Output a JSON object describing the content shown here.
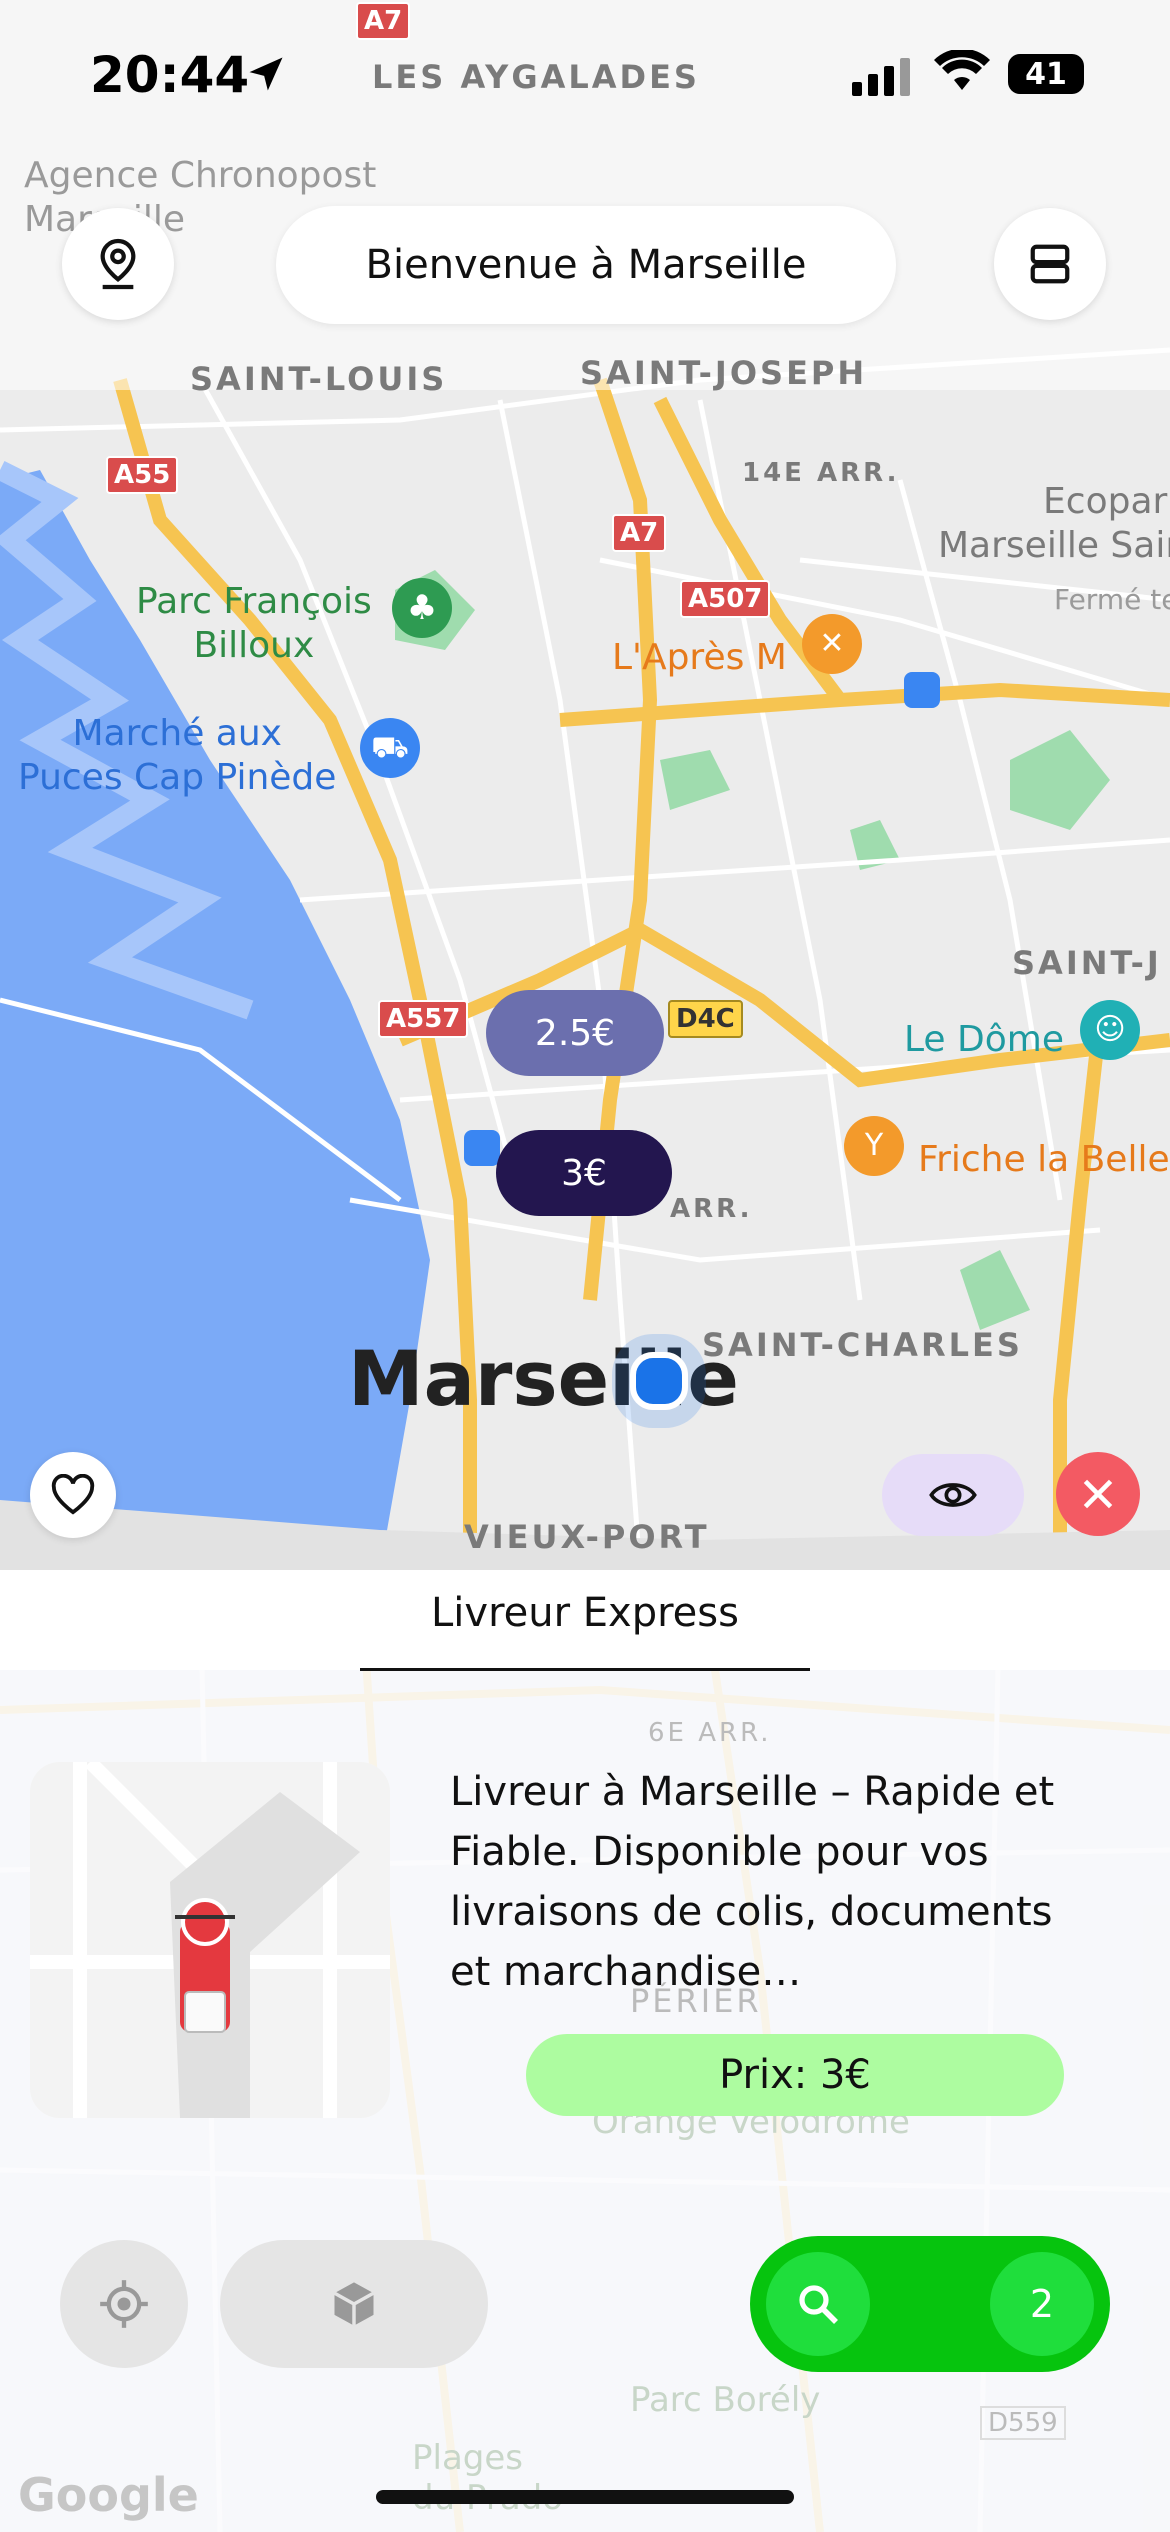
{
  "status_bar": {
    "time": "20:44",
    "battery": "41"
  },
  "header": {
    "title": "Bienvenue à Marseille"
  },
  "map": {
    "city_label": "Marseille",
    "area_labels": [
      "LES AYGALADES",
      "SAINT-LOUIS",
      "SAINT-JOSEPH",
      "14E ARR.",
      "SAINT-J",
      "ARR.",
      "SAINT-CHARLES",
      "VIEUX-PORT"
    ],
    "pois": {
      "chronopost": "Agence Chronopost\nMarseille",
      "parc": "Parc François\nBilloux",
      "marche": "Marché aux\nPuces Cap Pinède",
      "apres": "L'Après M",
      "ecopark": "Ecopark\nMarseille Sain",
      "ecopark_status": "Fermé te",
      "dome": "Le Dôme",
      "friche": "Friche la Belle"
    },
    "road_shields": [
      "A7",
      "A55",
      "A7",
      "A507",
      "A557",
      "D4C"
    ],
    "price_markers": [
      {
        "label": "2.5€",
        "color": "#6b6fae"
      },
      {
        "label": "3€",
        "color": "#23164f"
      }
    ]
  },
  "tab": {
    "label": "Livreur Express"
  },
  "listing": {
    "description": "Livreur à Marseille – Rapide et Fiable. Disponible pour vos livraisons de colis, documents et marchandise…",
    "price": "Prix: 3€"
  },
  "bottom_map_labels": [
    "6E ARR.",
    "PÉRIER",
    "Orange Vélodrome",
    "Parc Borély",
    "Plages\ndu Prado",
    "D559",
    "Google"
  ],
  "actions": {
    "search_count": "2"
  },
  "colors": {
    "accent_green": "#06c40e",
    "price_green": "#adfca0",
    "close_red": "#f35a63",
    "eye_purple": "#e6dcf8"
  }
}
